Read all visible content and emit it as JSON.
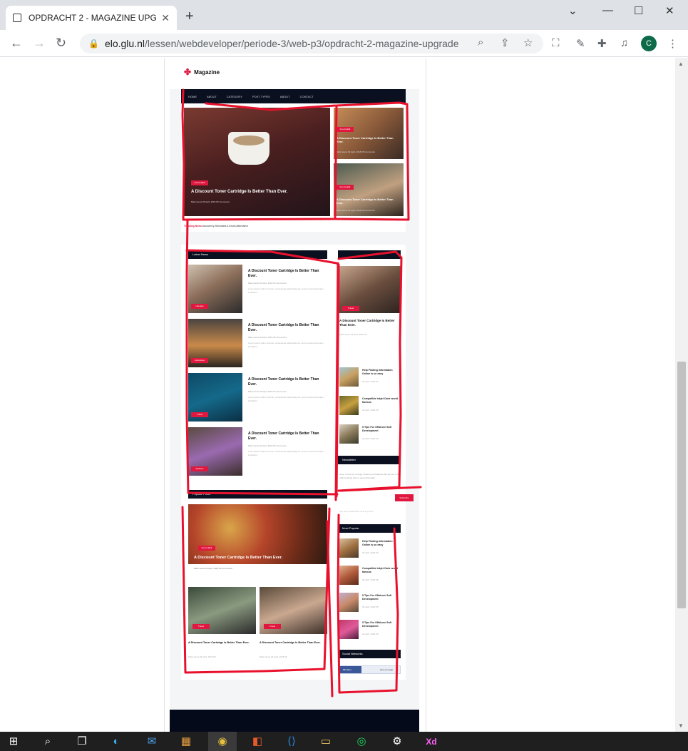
{
  "browser": {
    "tab_title": "OPDRACHT 2 - MAGAZINE UPGR",
    "tab_close": "✕",
    "new_tab": "+",
    "win_minimize": "—",
    "win_maximize": "☐",
    "win_close": "✕",
    "url_domain": "elo.glu.nl",
    "url_path": "/lessen/webdeveloper/periode-3/web-p3/opdracht-2-magazine-upgrade",
    "profile_initial": "C"
  },
  "magazine": {
    "logo": "Magazine",
    "nav": [
      "HOME",
      "ABOUT",
      "CATEGORY",
      "POST TYPES",
      "ABOUT",
      "CONTACT"
    ],
    "hero": {
      "main_badge": "Food Habit",
      "main_title": "A Discount Toner Cartridge Is Better Than Ever.",
      "main_meta": "Mark wiens   03 April, 2018   05 Comments",
      "side1_badge": "Food Habit",
      "side1_title": "A Discount Toner Cartridge Is Better Than Ever.",
      "side1_meta": "Mark wiens   03 April, 2018   05 Comments",
      "side2_badge": "Food Habit",
      "side2_title": "A Discount Toner Cartridge Is Better Than Ever.",
      "side2_meta": "Mark wiens   03 April, 2018   05 Comments"
    },
    "trending_label": "Trending News",
    "trending_text": "Adoxcerny Eliminates A Drunk Alternative",
    "latest_header": "Latest News",
    "latest": [
      {
        "badge": "Lifestyle",
        "title": "A Discount Toner Cartridge Is Better Than Ever.",
        "meta": "Mark wiens   03 April, 2018   05 Comments",
        "desc": "Lorem ipsum dolor sit amet, consectetur adipisicing elit, sed do eiusmod tempor incididunt"
      },
      {
        "badge": "Adventure",
        "title": "A Discount Toner Cartridge Is Better Than Ever.",
        "meta": "Mark wiens   03 April, 2018   05 Comments",
        "desc": "Lorem ipsum dolor sit amet, consectetur adipisicing elit, sed do eiusmod tempor incididunt"
      },
      {
        "badge": "Travel",
        "title": "A Discount Toner Cartridge Is Better Than Ever.",
        "meta": "Mark wiens   03 April, 2018   05 Comments",
        "desc": "Lorem ipsum dolor sit amet, consectetur adipisicing elit, sed do eiusmod tempor incididunt"
      },
      {
        "badge": "Fashion",
        "title": "A Discount Toner Cartridge Is Better Than Ever.",
        "meta": "Mark wiens   03 April, 2018   05 Comments",
        "desc": "Lorem ipsum dolor sit amet, consectetur adipisicing elit, sed do eiusmod tempor incididunt"
      }
    ],
    "side_card": {
      "badge": "Travel",
      "title": "A Discount Toner Cartridge Is Better Than Ever.",
      "meta": "Mark wiens   03 April, 2018   05"
    },
    "side_list": [
      {
        "title": "Help Finding Information Online is so easy",
        "meta": "03 April, 2018   05"
      },
      {
        "title": "Compatible Inkjet Cartr world famous",
        "meta": "03 April, 2018   05"
      },
      {
        "title": "5 Tips For Offshore Soft Development",
        "meta": "03 April, 2018   05"
      }
    ],
    "newsletter_header": "Newsletter",
    "newsletter_text": "Here, I focus on a range of items and features that we use in life without giving them a second thought.",
    "subscribe": "Subscribe",
    "unsubscribe": "You can unsubscribe us at any time",
    "popular_header": "Popular Posts",
    "popular_big": {
      "badge": "Food Habit",
      "title": "A Discount Toner Cartridge Is Better Than Ever.",
      "meta": "Mark wiens   03 April, 2018   05 Comments"
    },
    "popular_small": [
      {
        "badge": "Travel",
        "title": "A Discount Toner Cartridge Is Better Than Ever.",
        "meta": "Mark wiens   03 April, 2018   05"
      },
      {
        "badge": "Travel",
        "title": "A Discount Toner Cartridge Is Better Than Ever.",
        "meta": "Mark wiens   03 April, 2018   05"
      }
    ],
    "most_popular_header": "Most Popular",
    "most_popular": [
      {
        "title": "Help Finding Information Online is so easy",
        "meta": "03 April, 2018   05"
      },
      {
        "title": "Compatible Inkjet Cartr world famous",
        "meta": "03 April, 2018   05"
      },
      {
        "title": "5 Tips For Offshore Soft Development",
        "meta": "03 April, 2018   05"
      },
      {
        "title": "5 Tips For Offshore Soft Development",
        "meta": "03 April, 2018   05"
      }
    ],
    "social_header": "Social Networks",
    "fb_count": "852 likes",
    "fb_like": "Like our page"
  },
  "colors": {
    "accent": "#e0173f",
    "dark": "#0b1020",
    "annotation": "#e8112d"
  }
}
